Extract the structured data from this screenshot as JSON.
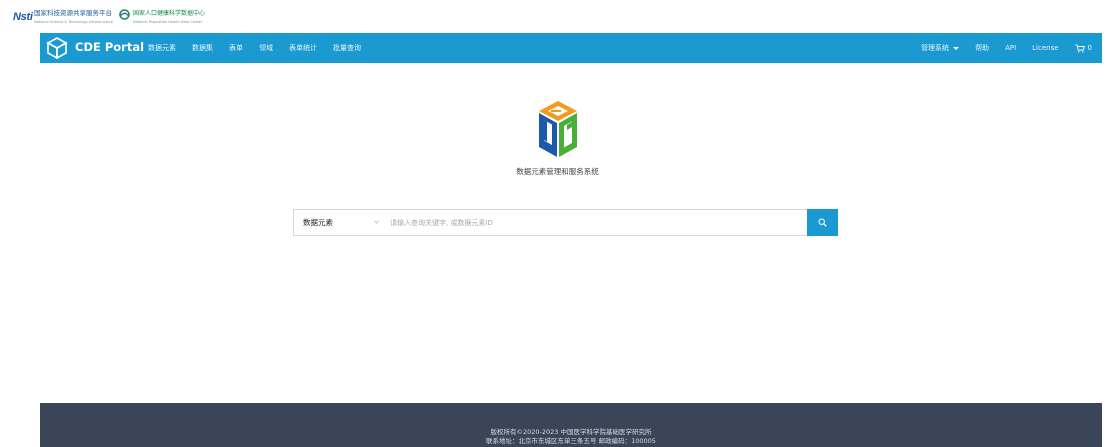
{
  "top_logos": {
    "nsti_mark": "Nsti",
    "nsti_cn": "国家科技资源共享服务平台",
    "nsti_en": "National Science & Technology Infrastructure",
    "ncp_cn": "国家人口健康科学数据中心",
    "ncp_en": "National Population Health Data Center"
  },
  "navbar": {
    "brand": "CDE Portal",
    "links": [
      "数据元素",
      "数据集",
      "表单",
      "领域",
      "表单统计",
      "批量查询"
    ],
    "right": {
      "manage": "管理系统",
      "help": "帮助",
      "api": "API",
      "license": "License",
      "cart_count": "0"
    }
  },
  "hero": {
    "title": "数据元素管理和服务系统"
  },
  "search": {
    "select_value": "数据元素",
    "placeholder": "请输入查询关键字, 或数据元素ID",
    "value": ""
  },
  "footer": {
    "line1": "版权所有©2020-2023   中国医学科学院基础医学研究所",
    "line2": "联系地址：北京市东城区东单三条五号   邮政编码：100005"
  },
  "colors": {
    "navbar": "#1a9ad1",
    "footer": "#3a4558",
    "logo_orange": "#f39b20",
    "logo_green": "#4cae3a",
    "logo_blue": "#1a5aa8"
  }
}
